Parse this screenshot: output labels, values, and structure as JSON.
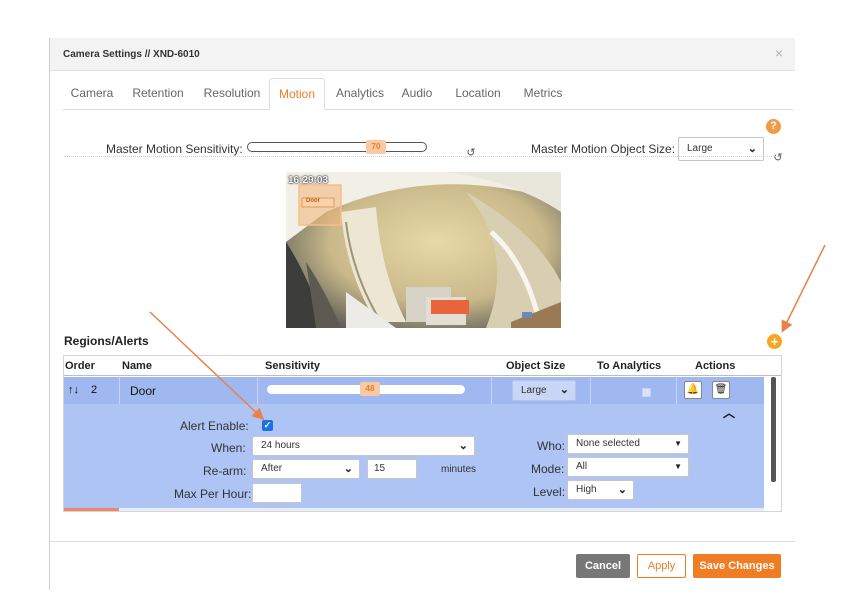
{
  "dialog": {
    "title": "Camera Settings // XND-6010",
    "close_glyph": "×"
  },
  "tabs": [
    {
      "label": "Camera"
    },
    {
      "label": "Retention"
    },
    {
      "label": "Resolution"
    },
    {
      "label": "Motion",
      "active": true
    },
    {
      "label": "Analytics"
    },
    {
      "label": "Audio"
    },
    {
      "label": "Location"
    },
    {
      "label": "Metrics"
    }
  ],
  "motion": {
    "sensitivity_label": "Master Motion Sensitivity:",
    "sensitivity_value": "70",
    "object_size_label": "Master Motion Object Size:",
    "object_size_value": "Large"
  },
  "camera_preview": {
    "timestamp": "16:29:03",
    "region_label": "Door"
  },
  "regions": {
    "title": "Regions/Alerts",
    "columns": [
      "Order",
      "Name",
      "Sensitivity",
      "Object Size",
      "To Analytics",
      "Actions"
    ],
    "row": {
      "order": "2",
      "name": "Door",
      "sensitivity": "48",
      "object_size": "Large"
    },
    "detail": {
      "alert_enable_label": "Alert Enable:",
      "when_label": "When:",
      "when_value": "24 hours",
      "rearm_label": "Re-arm:",
      "rearm_value": "After",
      "rearm_amount": "15",
      "rearm_unit": "minutes",
      "max_per_hour_label": "Max Per Hour:",
      "max_per_hour_value": "",
      "who_label": "Who:",
      "who_value": "None selected",
      "mode_label": "Mode:",
      "mode_value": "All",
      "level_label": "Level:",
      "level_value": "High"
    }
  },
  "footer": {
    "cancel": "Cancel",
    "apply": "Apply",
    "save": "Save Changes"
  },
  "colors": {
    "accent": "#f07c24",
    "row_selected": "#9fb8f0",
    "row_detail": "#adc4f5",
    "annotation_arrow": "#e8824a"
  }
}
